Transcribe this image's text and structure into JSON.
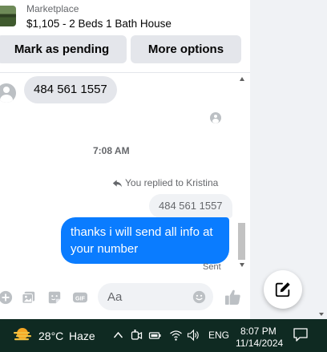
{
  "listing": {
    "source": "Marketplace",
    "title": "$1,105 - 2 Beds 1 Bath House"
  },
  "actions": {
    "mark_pending": "Mark as pending",
    "more_options": "More options"
  },
  "messages": {
    "incoming_text": "484 561 1557",
    "timestamp": "7:08 AM",
    "reply_label": "You replied to Kristina",
    "quoted_text": "484 561 1557",
    "outgoing_text": "thanks i will send all info at your number",
    "status": "Sent"
  },
  "composer": {
    "placeholder": "Aa"
  },
  "taskbar": {
    "temperature": "28°C",
    "condition": "Haze",
    "language": "ENG",
    "time": "8:07 PM",
    "date": "11/14/2024"
  },
  "colors": {
    "accent": "#0a7cff",
    "taskbar": "#0f2a22"
  }
}
